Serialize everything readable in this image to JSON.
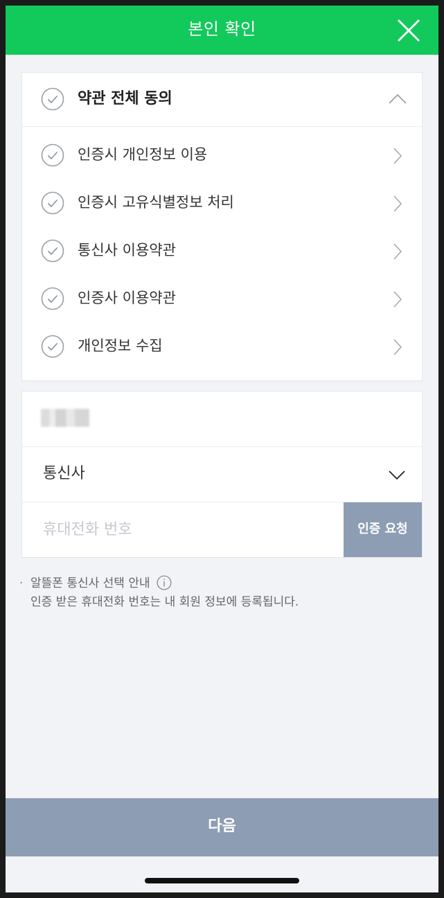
{
  "header": {
    "title": "본인 확인",
    "close_icon": "close-icon"
  },
  "terms": {
    "all_label": "약관 전체 동의",
    "items": [
      {
        "label": "인증시 개인정보 이용"
      },
      {
        "label": "인증시 고유식별정보 처리"
      },
      {
        "label": "통신사 이용약관"
      },
      {
        "label": "인증사 이용약관"
      },
      {
        "label": "개인정보 수집"
      }
    ]
  },
  "form": {
    "carrier_label": "통신사",
    "phone_placeholder": "휴대전화 번호",
    "verify_label": "인증 요청"
  },
  "notes": {
    "bullet": "·",
    "mvno_label": "알뜰폰 통신사 선택 안내",
    "registration_note": "인증 받은 휴대전화 번호는 내 회원 정보에 등록됩니다."
  },
  "footer": {
    "next_label": "다음"
  },
  "colors": {
    "header_green": "#12c95b",
    "button_gray_blue": "#8d9db3",
    "background": "#f1f3f7"
  }
}
